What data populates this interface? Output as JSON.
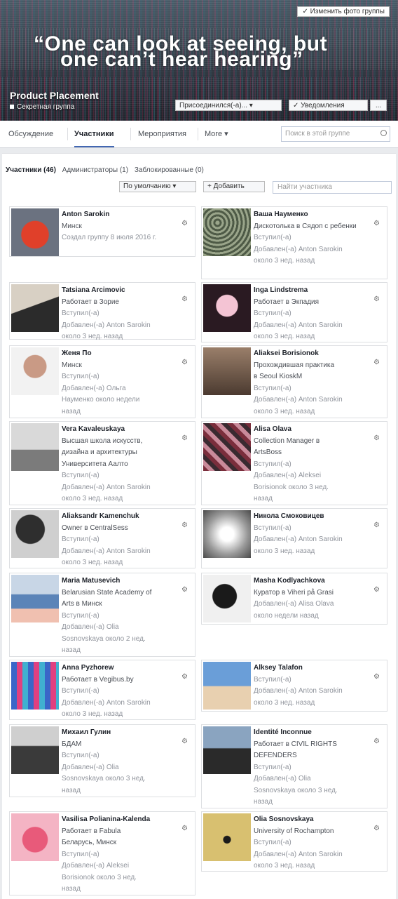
{
  "cover": {
    "quote_line1": "“One can look at seeing, but",
    "quote_line2": "one can’t hear hearing”",
    "change_photo_label": "✓ Изменить фото группы",
    "group_name": "Product Placement",
    "group_type": "Секретная группа"
  },
  "header_buttons": {
    "joined": "Присоединился(-а)... ▾",
    "notifications": "✓ Уведомления",
    "more": "..."
  },
  "tabs": [
    {
      "label": "Обсуждение"
    },
    {
      "label": "Участники"
    },
    {
      "label": "Мероприятия"
    },
    {
      "label": "More ▾"
    }
  ],
  "group_search_placeholder": "Поиск в этой группе",
  "filters": {
    "members": "Участники (46)",
    "admins": "Администраторы (1)",
    "blocked": "Заблокированные (0)"
  },
  "sort_label": "По умолчанию ▾",
  "add_label": "+ Добавить",
  "member_search_placeholder": "Найти участника",
  "members": [
    {
      "name": "Anton Sarokin",
      "lines": [
        "Минск"
      ],
      "meta": [
        "Создал группу 8 июля 2016 г."
      ]
    },
    {
      "name": "Ваша Науменко",
      "lines": [
        "Дискотолька в Сядоп с ребенки"
      ],
      "meta": [
        "Вступил(-а)",
        "Добавлен(-а) Anton Sarokin",
        "около 3 нед. назад"
      ]
    },
    {
      "name": "Tatsiana Arcimovic",
      "lines": [
        "Работает в Зорие"
      ],
      "meta": [
        "Вступил(-а)",
        "Добавлен(-а) Anton Sarokin",
        "около 3 нед. назад"
      ]
    },
    {
      "name": "Inga Lindstrema",
      "lines": [
        "Работает в Экпадия"
      ],
      "meta": [
        "Вступил(-а)",
        "Добавлен(-а) Anton Sarokin",
        "около 3 нед. назад"
      ]
    },
    {
      "name": "Женя По",
      "lines": [
        "Минск"
      ],
      "meta": [
        "Вступил(-а)",
        "Добавлен(-а) Ольга",
        "Науменко около недели",
        "назад"
      ]
    },
    {
      "name": "Aliaksei Borisionok",
      "lines": [
        "Прохождившая практика",
        "в Seoul KioskM"
      ],
      "meta": [
        "Вступил(-а)",
        "Добавлен(-а) Anton Sarokin",
        "около 3 нед. назад"
      ]
    },
    {
      "name": "Vera Kavaleuskaya",
      "lines": [
        "Высшая школа искусств,",
        "дизайна и архитектуры",
        "Университета Аалто"
      ],
      "meta": [
        "Вступил(-а)",
        "Добавлен(-а) Anton Sarokin",
        "около 3 нед. назад"
      ]
    },
    {
      "name": "Alisa Olava",
      "lines": [
        "Collection Manager в",
        "ArtsBoss"
      ],
      "meta": [
        "Вступил(-а)",
        "Добавлен(-а) Aleksei",
        "Borisionok около 3 нед.",
        "назад"
      ]
    },
    {
      "name": "Aliaksandr Kamenchuk",
      "lines": [
        "Owner в CentralSess"
      ],
      "meta": [
        "Вступил(-а)",
        "Добавлен(-а) Anton Sarokin",
        "около 3 нед. назад"
      ]
    },
    {
      "name": "Никола Смоковицев",
      "lines": [],
      "meta": [
        "Вступил(-а)",
        "Добавлен(-а) Anton Sarokin",
        "около 3 нед. назад"
      ]
    },
    {
      "name": "Maria Matusevich",
      "lines": [
        "Belarusian State Academy of",
        "Arts в Минск"
      ],
      "meta": [
        "Вступил(-а)",
        "Добавлен(-а) Olia",
        "Sosnovskaya около 2 нед.",
        "назад"
      ]
    },
    {
      "name": "Masha Kodlyachkova",
      "lines": [
        "Куратор в Viheri på Grasi"
      ],
      "meta": [
        "Добавлен(-а) Alisa Olava",
        "около недели назад"
      ]
    },
    {
      "name": "Anna Pyzhorew",
      "lines": [
        "Работает в Vegibus.by"
      ],
      "meta": [
        "Вступил(-а)",
        "Добавлен(-а) Anton Sarokin",
        "около 3 нед. назад"
      ]
    },
    {
      "name": "Alksey Talafon",
      "lines": [],
      "meta": [
        "Вступил(-а)",
        "Добавлен(-а) Anton Sarokin",
        "около 3 нед. назад"
      ]
    },
    {
      "name": "Михаил Гулин",
      "lines": [
        "БДАМ"
      ],
      "meta": [
        "Вступил(-а)",
        "Добавлен(-а) Olia",
        "Sosnovskaya около 3 нед.",
        "назад"
      ]
    },
    {
      "name": "Identité Inconnue",
      "lines": [
        "Работает в CIVIL RIGHTS",
        "DEFENDERS"
      ],
      "meta": [
        "Вступил(-а)",
        "Добавлен(-а) Olia",
        "Sosnovskaya около 3 нед.",
        "назад"
      ]
    },
    {
      "name": "Vasilisa Polianina-Kalenda",
      "lines": [
        "Работает в Fabula",
        "Беларусь, Минск"
      ],
      "meta": [
        "Вступил(-а)",
        "Добавлен(-а) Aleksei",
        "Borisionok около 3 нед.",
        "назад"
      ]
    },
    {
      "name": "Olia Sosnovskaya",
      "lines": [
        "University of Rochampton"
      ],
      "meta": [
        "Вступил(-а)",
        "Добавлен(-а) Anton Sarokin",
        "около 3 нед. назад"
      ]
    }
  ],
  "gear_glyph": "⚙"
}
